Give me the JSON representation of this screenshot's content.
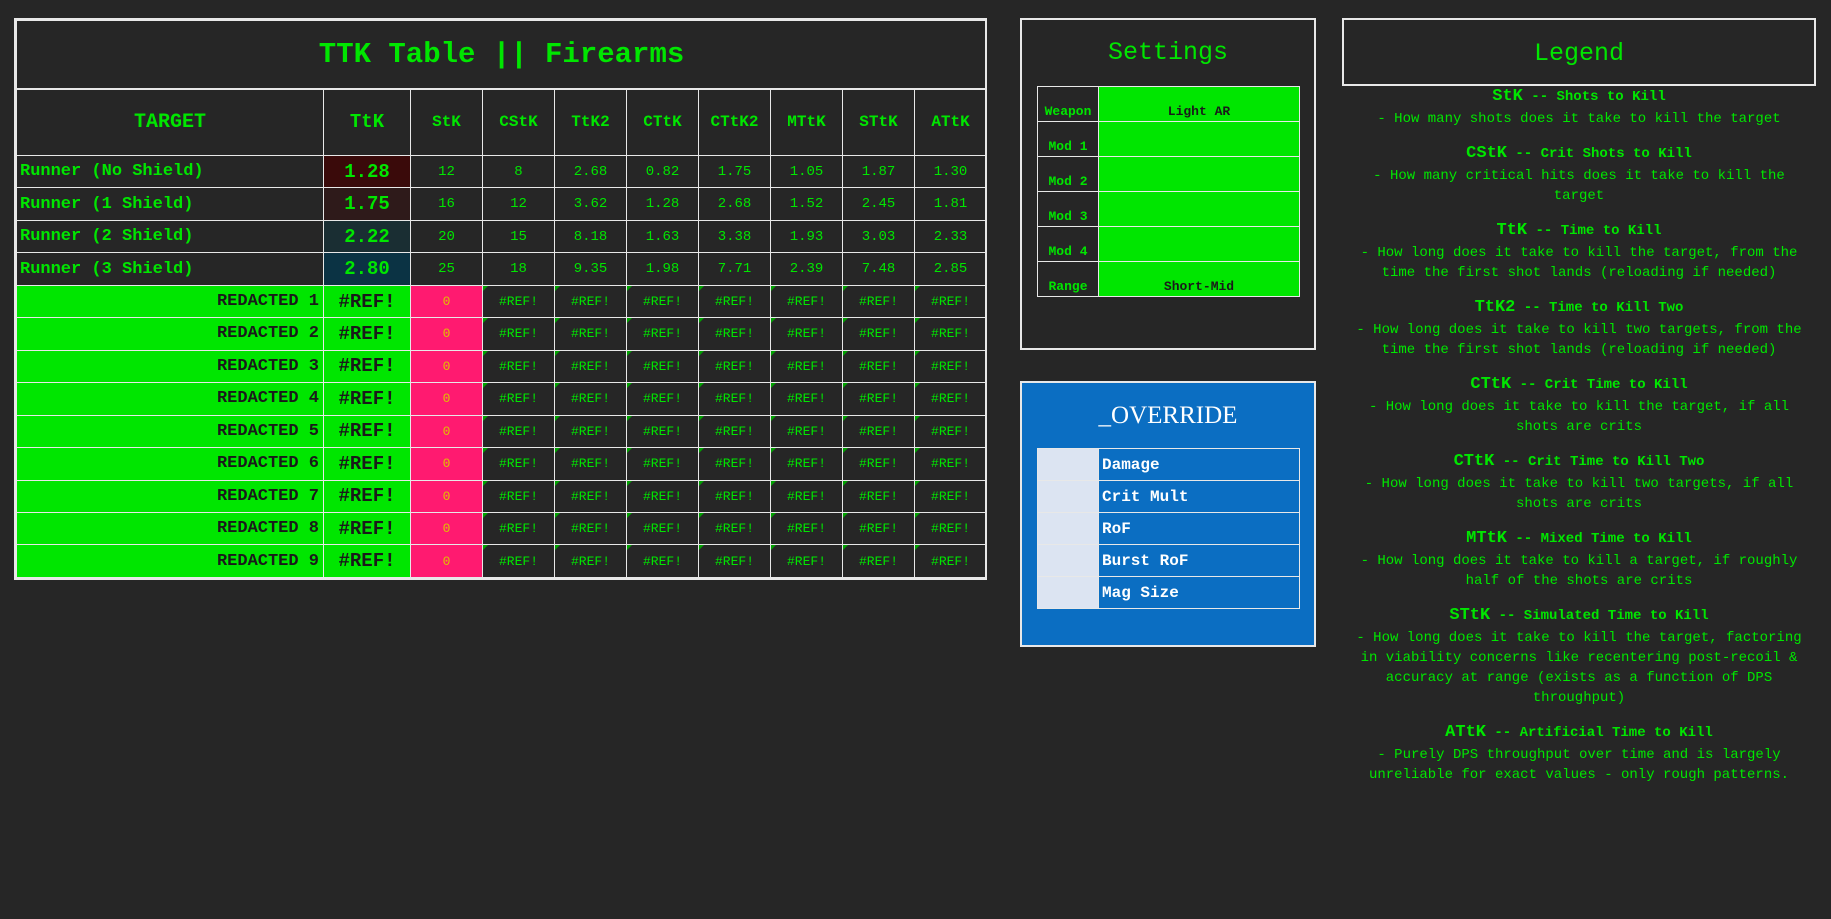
{
  "ttk_table": {
    "title": "TTK Table || Firearms",
    "headers": [
      "TARGET",
      "TtK",
      "StK",
      "CStK",
      "TtK2",
      "CTtK",
      "CTtK2",
      "MTtK",
      "STtK",
      "ATtK"
    ],
    "rows": [
      {
        "target": "Runner (No Shield)",
        "ttk": "1.28",
        "ttk_bg": "#3a0a0a",
        "values": [
          "12",
          "8",
          "2.68",
          "0.82",
          "1.75",
          "1.05",
          "1.87",
          "1.30"
        ]
      },
      {
        "target": "Runner (1 Shield)",
        "ttk": "1.75",
        "ttk_bg": "#2e1a1a",
        "values": [
          "16",
          "12",
          "3.62",
          "1.28",
          "2.68",
          "1.52",
          "2.45",
          "1.81"
        ]
      },
      {
        "target": "Runner (2 Shield)",
        "ttk": "2.22",
        "ttk_bg": "#1a2e33",
        "values": [
          "20",
          "15",
          "8.18",
          "1.63",
          "3.38",
          "1.93",
          "3.03",
          "2.33"
        ]
      },
      {
        "target": "Runner (3 Shield)",
        "ttk": "2.80",
        "ttk_bg": "#0b3344",
        "values": [
          "25",
          "18",
          "9.35",
          "1.98",
          "7.71",
          "2.39",
          "7.48",
          "2.85"
        ]
      }
    ],
    "redacted_rows": [
      {
        "target": "REDACTED 1",
        "ttk": "#REF!",
        "stk": "0",
        "values": [
          "#REF!",
          "#REF!",
          "#REF!",
          "#REF!",
          "#REF!",
          "#REF!",
          "#REF!"
        ]
      },
      {
        "target": "REDACTED 2",
        "ttk": "#REF!",
        "stk": "0",
        "values": [
          "#REF!",
          "#REF!",
          "#REF!",
          "#REF!",
          "#REF!",
          "#REF!",
          "#REF!"
        ]
      },
      {
        "target": "REDACTED 3",
        "ttk": "#REF!",
        "stk": "0",
        "values": [
          "#REF!",
          "#REF!",
          "#REF!",
          "#REF!",
          "#REF!",
          "#REF!",
          "#REF!"
        ]
      },
      {
        "target": "REDACTED 4",
        "ttk": "#REF!",
        "stk": "0",
        "values": [
          "#REF!",
          "#REF!",
          "#REF!",
          "#REF!",
          "#REF!",
          "#REF!",
          "#REF!"
        ]
      },
      {
        "target": "REDACTED 5",
        "ttk": "#REF!",
        "stk": "0",
        "values": [
          "#REF!",
          "#REF!",
          "#REF!",
          "#REF!",
          "#REF!",
          "#REF!",
          "#REF!"
        ]
      },
      {
        "target": "REDACTED 6",
        "ttk": "#REF!",
        "stk": "0",
        "values": [
          "#REF!",
          "#REF!",
          "#REF!",
          "#REF!",
          "#REF!",
          "#REF!",
          "#REF!"
        ]
      },
      {
        "target": "REDACTED 7",
        "ttk": "#REF!",
        "stk": "0",
        "values": [
          "#REF!",
          "#REF!",
          "#REF!",
          "#REF!",
          "#REF!",
          "#REF!",
          "#REF!"
        ]
      },
      {
        "target": "REDACTED 8",
        "ttk": "#REF!",
        "stk": "0",
        "values": [
          "#REF!",
          "#REF!",
          "#REF!",
          "#REF!",
          "#REF!",
          "#REF!",
          "#REF!"
        ]
      },
      {
        "target": "REDACTED 9",
        "ttk": "#REF!",
        "stk": "0",
        "values": [
          "#REF!",
          "#REF!",
          "#REF!",
          "#REF!",
          "#REF!",
          "#REF!",
          "#REF!"
        ]
      }
    ]
  },
  "settings": {
    "title": "Settings",
    "rows": [
      {
        "label": "Weapon",
        "value": "Light AR"
      },
      {
        "label": "Mod 1",
        "value": ""
      },
      {
        "label": "Mod 2",
        "value": ""
      },
      {
        "label": "Mod 3",
        "value": ""
      },
      {
        "label": "Mod 4",
        "value": ""
      },
      {
        "label": "Range",
        "value": "Short-Mid"
      }
    ]
  },
  "override": {
    "title": "_OVERRIDE",
    "items": [
      "Damage",
      "Crit Mult",
      "RoF",
      "Burst RoF",
      "Mag Size"
    ]
  },
  "legend": {
    "title": "Legend",
    "entries": [
      {
        "abbr": "StK",
        "full": " -- Shots to Kill",
        "desc": "- How many shots does it take to kill the target"
      },
      {
        "abbr": "CStK",
        "full": " -- Crit Shots to Kill",
        "desc": "- How many critical hits does it take to kill the target"
      },
      {
        "abbr": "TtK",
        "full": " -- Time to Kill",
        "desc": "- How long does it take to kill the target, from the time the first shot lands (reloading if needed)"
      },
      {
        "abbr": "TtK2",
        "full": " -- Time to Kill Two",
        "desc": "- How long does it take to kill two targets, from the time the first shot lands (reloading if needed)"
      },
      {
        "abbr": "CTtK",
        "full": " -- Crit Time to Kill",
        "desc": "- How long does it take to kill the target, if all shots are crits"
      },
      {
        "abbr": "CTtK",
        "full": " -- Crit Time to Kill Two",
        "desc": "- How long does it take to kill two targets, if all shots are crits"
      },
      {
        "abbr": "MTtK",
        "full": " -- Mixed Time to Kill",
        "desc": "- How long does it take to kill a target, if roughly half of the shots are crits"
      },
      {
        "abbr": "STtK",
        "full": " -- Simulated Time to Kill",
        "desc": "- How long does it take to kill the target, factoring in viability concerns like recentering post-recoil & accuracy at range (exists as a function of DPS throughput)"
      },
      {
        "abbr": "ATtK",
        "full": " -- Artificial Time to Kill",
        "desc": "- Purely DPS throughput over time and is largely unreliable for exact values - only rough patterns."
      }
    ]
  },
  "colors": {
    "background": "#262626",
    "text_green": "#00e600",
    "redacted_pink": "#ff1a70",
    "override_blue": "#0b6ec2"
  }
}
